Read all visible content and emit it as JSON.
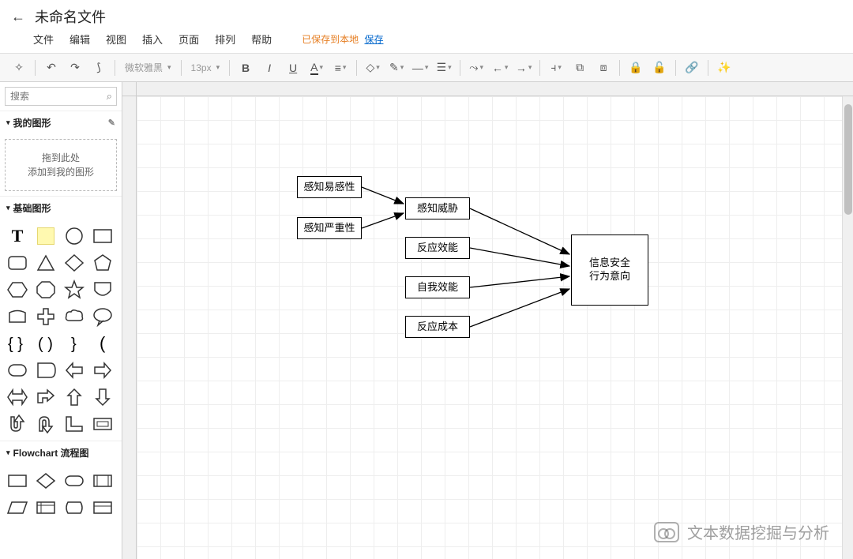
{
  "header": {
    "title": "未命名文件",
    "menu": [
      "文件",
      "编辑",
      "视图",
      "插入",
      "页面",
      "排列",
      "帮助"
    ],
    "save_status": "已保存到本地",
    "save_link": "保存"
  },
  "toolbar": {
    "font": "微软雅黑",
    "fontsize": "13px"
  },
  "sidebar": {
    "search_placeholder": "搜索",
    "panels": {
      "my_shapes": "我的图形",
      "basic_shapes": "基础图形",
      "flowchart": "Flowchart 流程图"
    },
    "drop_zone_line1": "拖到此处",
    "drop_zone_line2": "添加到我的图形"
  },
  "diagram": {
    "nodes": {
      "n1": "感知易感性",
      "n2": "感知严重性",
      "n3": "感知威胁",
      "n4": "反应效能",
      "n5": "自我效能",
      "n6": "反应成本",
      "n7_line1": "信息安全",
      "n7_line2": "行为意向"
    }
  },
  "watermark": "文本数据挖掘与分析"
}
